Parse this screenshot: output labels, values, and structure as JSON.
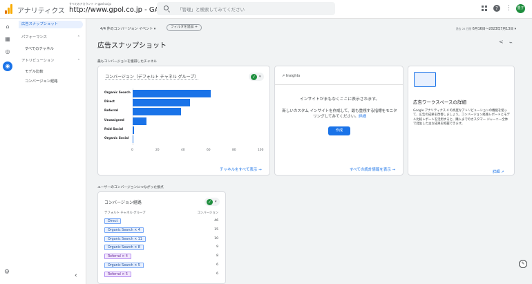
{
  "header": {
    "brand": "アナリティクス",
    "account_crumb": "すべてのアカウント > gpol.co.jp",
    "property": "http://www.gpol.co.jp - GA4",
    "property_caret": "▾",
    "search_placeholder": "「管理」と検索してみてください",
    "avatar_text": "豊子"
  },
  "nav": {
    "active_item": "広告スナップショット",
    "performance": "パフォーマンス",
    "all_channels": "すべてのチャネル",
    "attribution": "アトリビューション",
    "model_comparison": "モデル比較",
    "conversion_paths": "コンバージョン経路"
  },
  "filterbar": {
    "conversion_events": "4/4 件のコンバージョン イベント ▾",
    "add_filter": "フィルタを追加 +",
    "date_prefix": "過去 28 日間",
    "date_range": "6月16日～2023年7月13日 ▾"
  },
  "page": {
    "title": "広告スナップショット",
    "section1": "最もコンバージョンを獲得したチャネル",
    "section2": "ユーザーのコンバージョンにつながった接点"
  },
  "channel_card": {
    "title": "コンバージョン（デフォルト チャネル グループ）",
    "see_all": "チャネルをすべて表示 →"
  },
  "chart_data": {
    "type": "bar",
    "categories": [
      "Organic Search",
      "Direct",
      "Referral",
      "Unassigned",
      "Paid Social",
      "Organic Social"
    ],
    "values": [
      61,
      45,
      38,
      11,
      1,
      0
    ],
    "xticks": [
      "0",
      "20",
      "40",
      "60",
      "80",
      "100"
    ],
    "xlim": [
      0,
      100
    ],
    "orientation": "horizontal",
    "color": "#1a73e8"
  },
  "insights_card": {
    "title": "Insights",
    "message": "インサイトがまもなくここに表示されます。",
    "description": "新しいカスタム インサイトを作成して、最も重視する指標をモニタリングしてみてください。",
    "details_link": "詳細",
    "create_button": "作成",
    "see_all": "すべての統計情報を表示 →"
  },
  "workspace_card": {
    "title": "広告ワークスペースの詳細",
    "description": "Google アナリティクス 4 の高度なアトリビューションの機能を使って、広告の成果を改善しましょう。コンバージョン経路レポートとモデル比較レポートを活用すると、購入までのカスタマー ジャーニー全体で発生した主な成果を把握できます。",
    "details_link": "詳細 ↗"
  },
  "paths_card": {
    "title": "コンバージョン経路",
    "col_left": "デフォルト チャネル グループ",
    "col_right": "コンバージョン",
    "rows": [
      {
        "label": "Direct",
        "value": "46",
        "color": "blue"
      },
      {
        "label": "Organic Search × 4",
        "value": "15",
        "color": "blue"
      },
      {
        "label": "Organic Search × 11",
        "value": "10",
        "color": "blue"
      },
      {
        "label": "Organic Search × 8",
        "value": "9",
        "color": "blue"
      },
      {
        "label": "Referral × 4",
        "value": "8",
        "color": "purple"
      },
      {
        "label": "Organic Search × 5",
        "value": "6",
        "color": "blue"
      },
      {
        "label": "Referral × 5",
        "value": "6",
        "color": "purple"
      }
    ]
  },
  "colors": {
    "accent": "#1a73e8",
    "logo_orange": "#f9ab00",
    "logo_dark": "#e37400",
    "avatar": "#1e8e3e"
  }
}
